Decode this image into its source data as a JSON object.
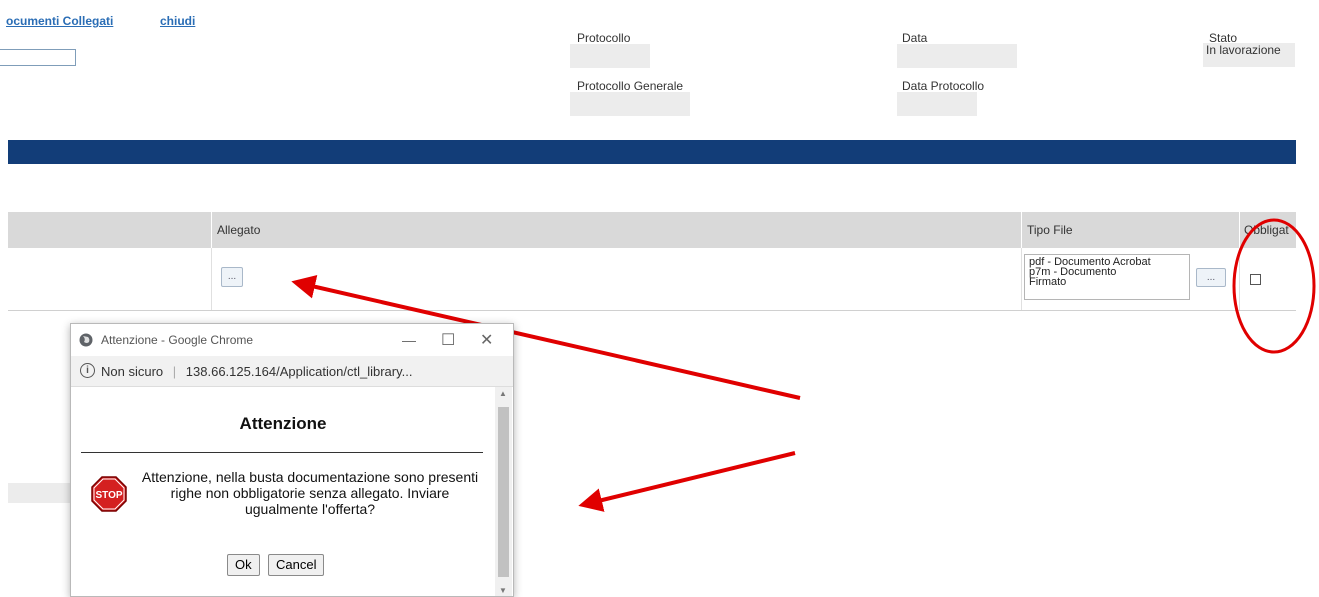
{
  "top_links": {
    "documenti_collegati": "ocumenti Collegati",
    "chiudi": "chiudi"
  },
  "header_fields": {
    "protocollo_label": "Protocollo",
    "data_label": "Data",
    "stato_label": "Stato",
    "stato_value": "In lavorazione",
    "protocollo_generale_label": "Protocollo Generale",
    "data_protocollo_label": "Data Protocollo"
  },
  "table": {
    "headers": {
      "allegato": "Allegato",
      "tipo_file": "Tipo File",
      "obbligatorio": "Obbligat"
    },
    "row": {
      "allegato_button": "...",
      "tipo_file_lines": [
        "pdf - Documento Acrobat",
        "p7m - Documento",
        "Firmato"
      ],
      "tipo_file_button": "..."
    }
  },
  "popup": {
    "window_title": "Attenzione - Google Chrome",
    "security_label": "Non sicuro",
    "url": "138.66.125.164/Application/ctl_library...",
    "heading": "Attenzione",
    "message": "Attenzione, nella busta documentazione sono presenti righe non obbligatorie senza allegato. Inviare ugualmente l'offerta?",
    "stop_icon_text": "STOP",
    "ok_label": "Ok",
    "cancel_label": "Cancel"
  },
  "colors": {
    "header_bar": "#123d78",
    "annotation": "#e00000",
    "link": "#2a6db5"
  }
}
